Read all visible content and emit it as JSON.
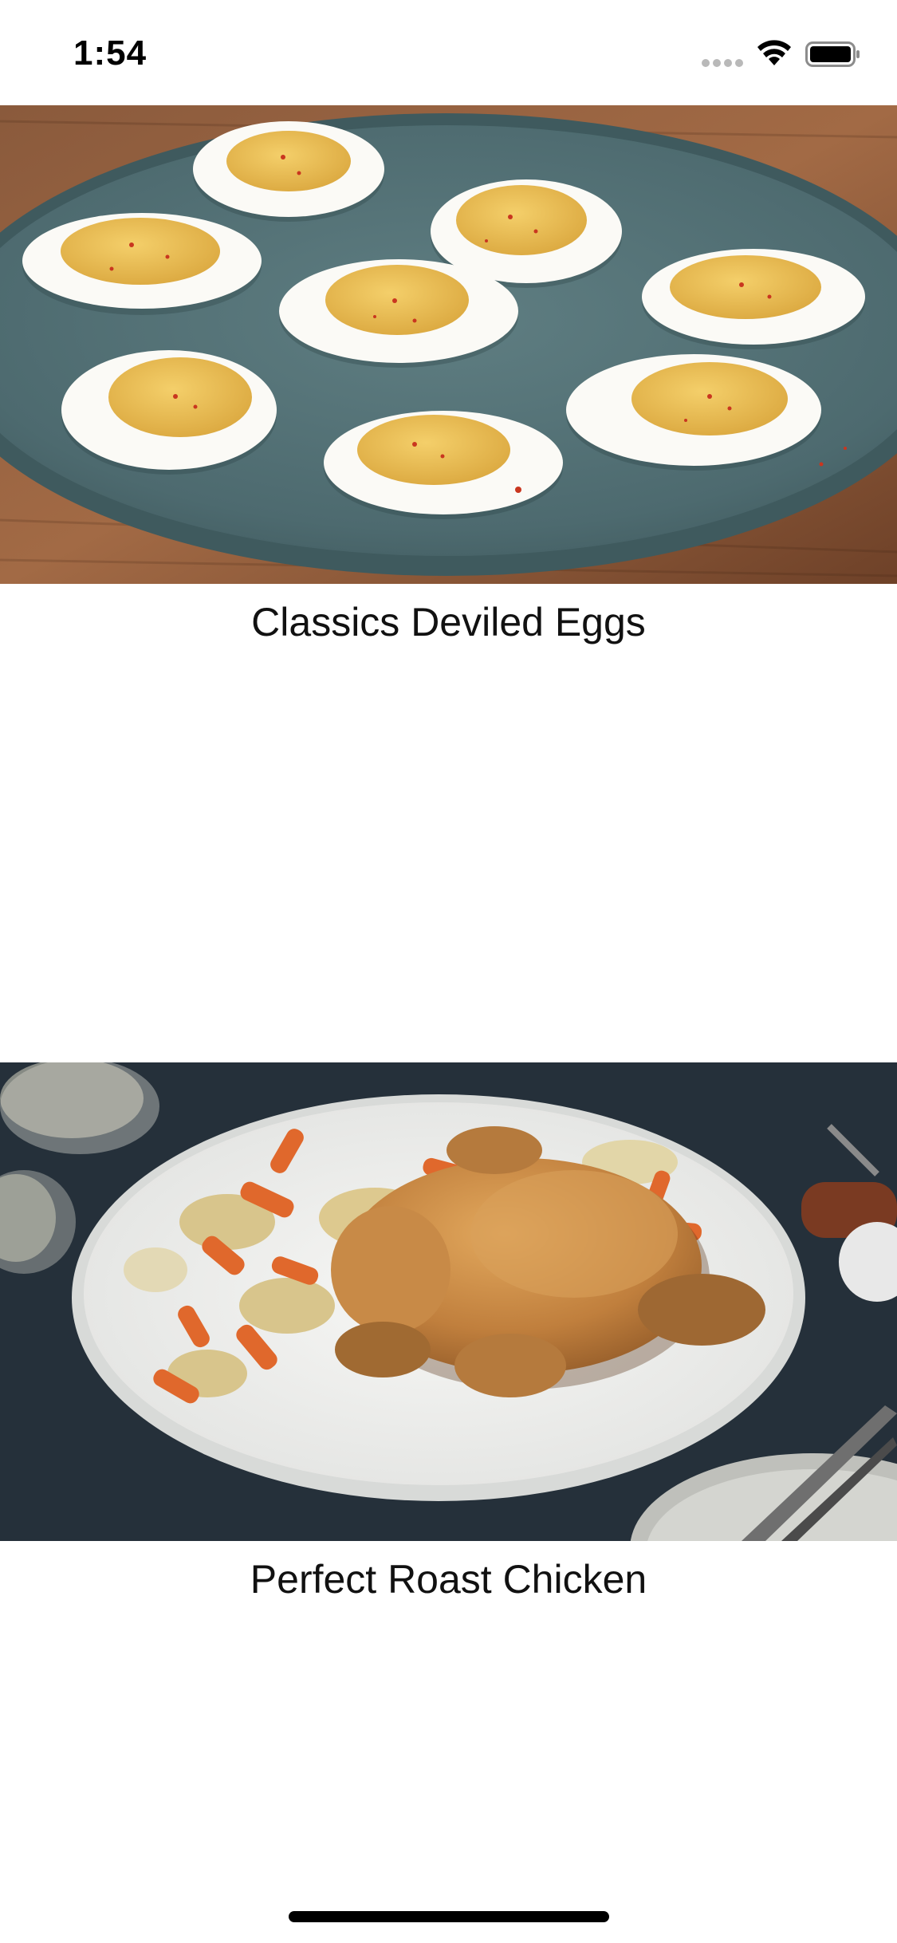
{
  "status_bar": {
    "time": "1:54",
    "icons": [
      "cellular-signal-icon",
      "wifi-icon",
      "battery-icon"
    ]
  },
  "recipes": [
    {
      "title": "Classics Deviled Eggs",
      "image": "deviled-eggs-photo"
    },
    {
      "title": "Perfect Roast Chicken",
      "image": "roast-chicken-photo"
    }
  ],
  "colors": {
    "background": "#ffffff",
    "text": "#111111",
    "home_indicator": "#000000"
  }
}
